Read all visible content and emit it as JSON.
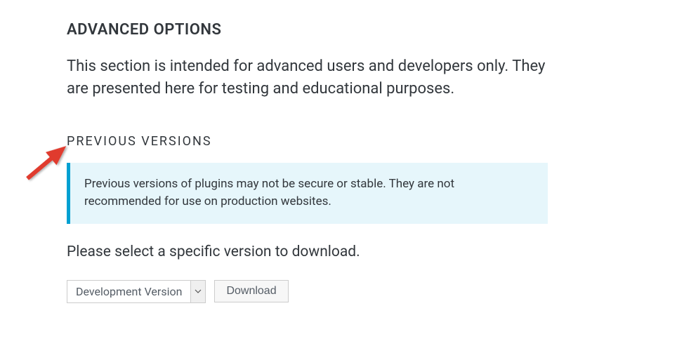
{
  "advanced": {
    "heading": "ADVANCED OPTIONS",
    "description": "This section is intended for advanced users and developers only. They are presented here for testing and educational purposes."
  },
  "previous_versions": {
    "heading": "PREVIOUS VERSIONS",
    "notice": "Previous versions of plugins may not be secure or stable. They are not recommended for use on production websites.",
    "instruction": "Please select a specific version to download.",
    "selected_version": "Development Version",
    "download_label": "Download"
  }
}
